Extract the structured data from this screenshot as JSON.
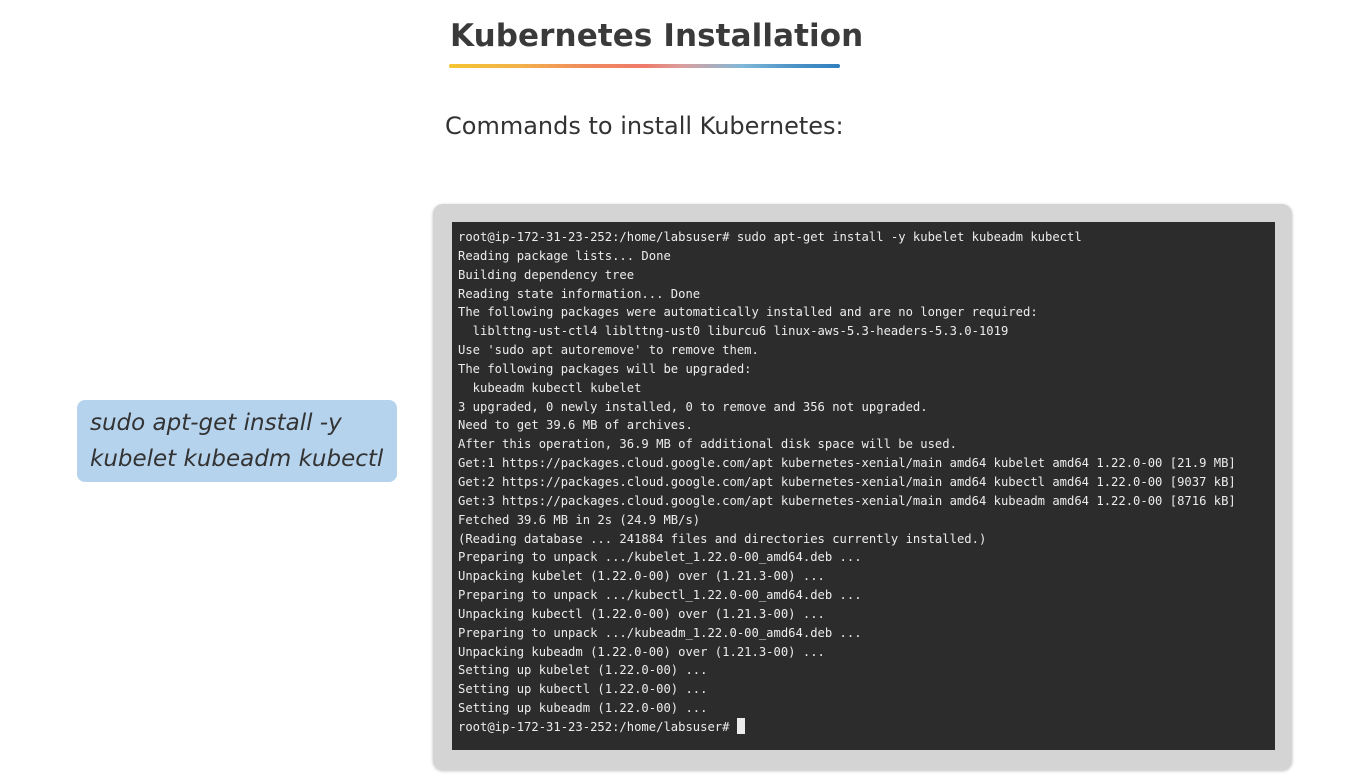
{
  "slide": {
    "title": "Kubernetes Installation",
    "subtitle": "Commands to install Kubernetes:",
    "callout": {
      "line1": "sudo apt-get install -y",
      "line2": "kubelet kubeadm kubectl"
    }
  },
  "terminal": {
    "lines": [
      "root@ip-172-31-23-252:/home/labsuser# sudo apt-get install -y kubelet kubeadm kubectl",
      "Reading package lists... Done",
      "Building dependency tree",
      "Reading state information... Done",
      "The following packages were automatically installed and are no longer required:",
      "  liblttng-ust-ctl4 liblttng-ust0 liburcu6 linux-aws-5.3-headers-5.3.0-1019",
      "Use 'sudo apt autoremove' to remove them.",
      "The following packages will be upgraded:",
      "  kubeadm kubectl kubelet",
      "3 upgraded, 0 newly installed, 0 to remove and 356 not upgraded.",
      "Need to get 39.6 MB of archives.",
      "After this operation, 36.9 MB of additional disk space will be used.",
      "Get:1 https://packages.cloud.google.com/apt kubernetes-xenial/main amd64 kubelet amd64 1.22.0-00 [21.9 MB]",
      "Get:2 https://packages.cloud.google.com/apt kubernetes-xenial/main amd64 kubectl amd64 1.22.0-00 [9037 kB]",
      "Get:3 https://packages.cloud.google.com/apt kubernetes-xenial/main amd64 kubeadm amd64 1.22.0-00 [8716 kB]",
      "Fetched 39.6 MB in 2s (24.9 MB/s)",
      "(Reading database ... 241884 files and directories currently installed.)",
      "Preparing to unpack .../kubelet_1.22.0-00_amd64.deb ...",
      "Unpacking kubelet (1.22.0-00) over (1.21.3-00) ...",
      "Preparing to unpack .../kubectl_1.22.0-00_amd64.deb ...",
      "Unpacking kubectl (1.22.0-00) over (1.21.3-00) ...",
      "Preparing to unpack .../kubeadm_1.22.0-00_amd64.deb ...",
      "Unpacking kubeadm (1.22.0-00) over (1.21.3-00) ...",
      "Setting up kubelet (1.22.0-00) ...",
      "Setting up kubectl (1.22.0-00) ...",
      "Setting up kubeadm (1.22.0-00) ...",
      "root@ip-172-31-23-252:/home/labsuser# "
    ]
  }
}
